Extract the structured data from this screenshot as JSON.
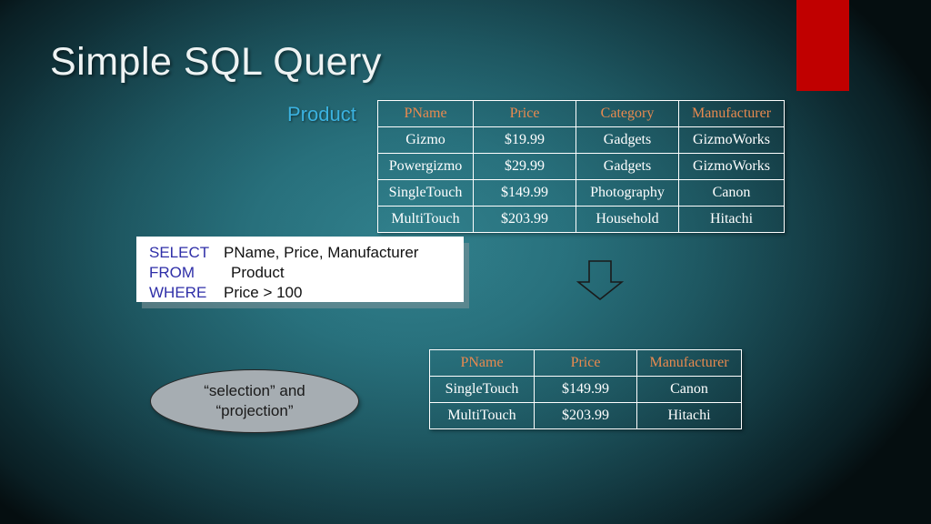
{
  "slide": {
    "title": "Simple SQL Query",
    "product_label": "Product",
    "accent_red": "#c00000",
    "header_orange": "#e98a4f",
    "label_blue": "#3bb2e0",
    "keyword_blue": "#2f2fa8"
  },
  "product_table": {
    "headers": [
      "PName",
      "Price",
      "Category",
      "Manufacturer"
    ],
    "rows": [
      [
        "Gizmo",
        "$19.99",
        "Gadgets",
        "GizmoWorks"
      ],
      [
        "Powergizmo",
        "$29.99",
        "Gadgets",
        "GizmoWorks"
      ],
      [
        "SingleTouch",
        "$149.99",
        "Photography",
        "Canon"
      ],
      [
        "MultiTouch",
        "$203.99",
        "Household",
        "Hitachi"
      ]
    ]
  },
  "sql": {
    "lines": [
      {
        "keyword": "SELECT",
        "rest": "PName, Price, Manufacturer"
      },
      {
        "keyword": "FROM",
        "rest": "Product"
      },
      {
        "keyword": "WHERE",
        "rest": "Price > 100"
      }
    ]
  },
  "result_table": {
    "headers": [
      "PName",
      "Price",
      "Manufacturer"
    ],
    "rows": [
      [
        "SingleTouch",
        "$149.99",
        "Canon"
      ],
      [
        "MultiTouch",
        "$203.99",
        "Hitachi"
      ]
    ]
  },
  "callout": {
    "line1": "“selection” and",
    "line2": "“projection”"
  }
}
